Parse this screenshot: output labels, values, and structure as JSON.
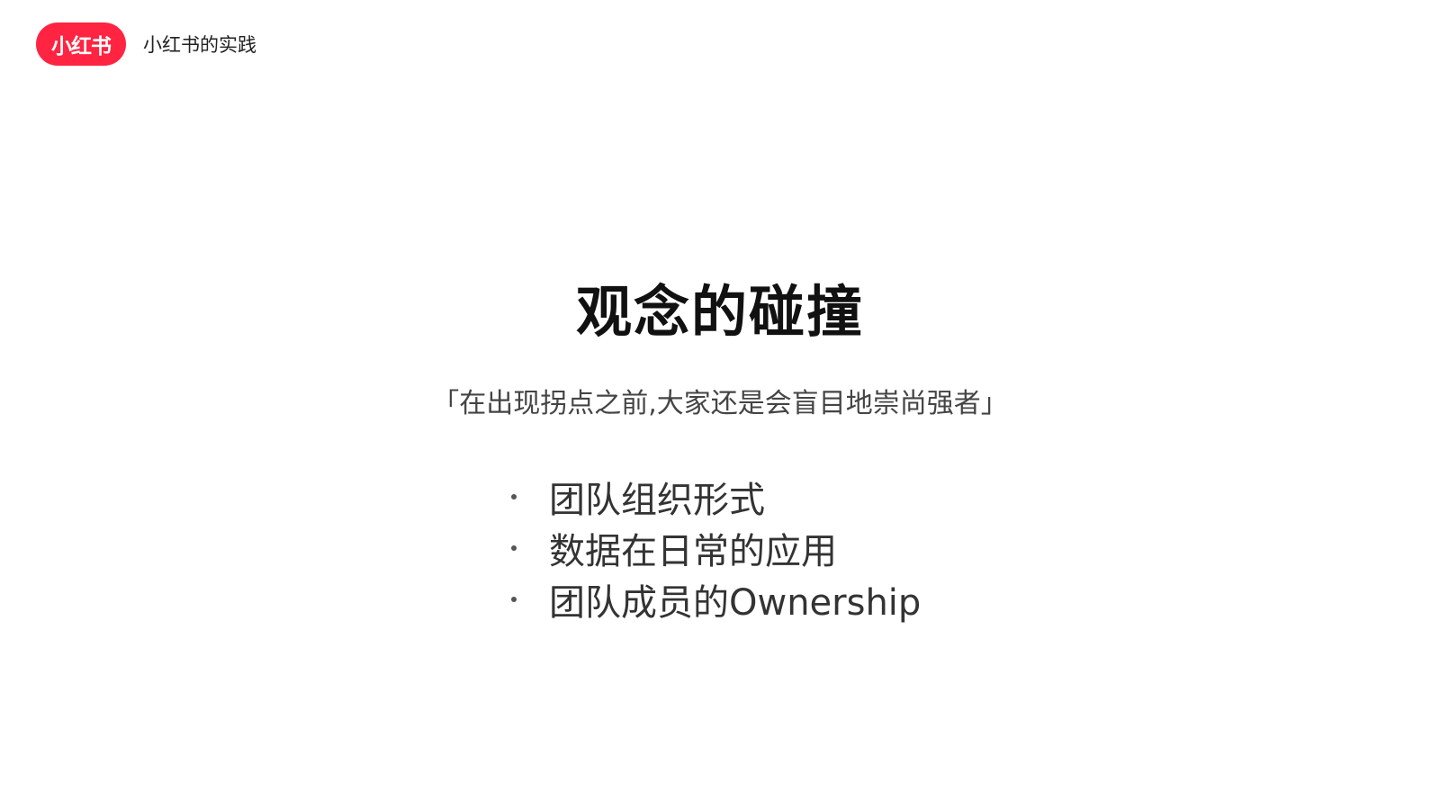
{
  "brand": {
    "logo_text": "小红书",
    "color": "#ff2442"
  },
  "header": {
    "title": "小红书的实践"
  },
  "main": {
    "title": "观念的碰撞",
    "quote": "「在出现拐点之前,大家还是会盲目地崇尚强者」",
    "bullets": [
      "团队组织形式",
      "数据在日常的应用",
      "团队成员的Ownership"
    ]
  }
}
